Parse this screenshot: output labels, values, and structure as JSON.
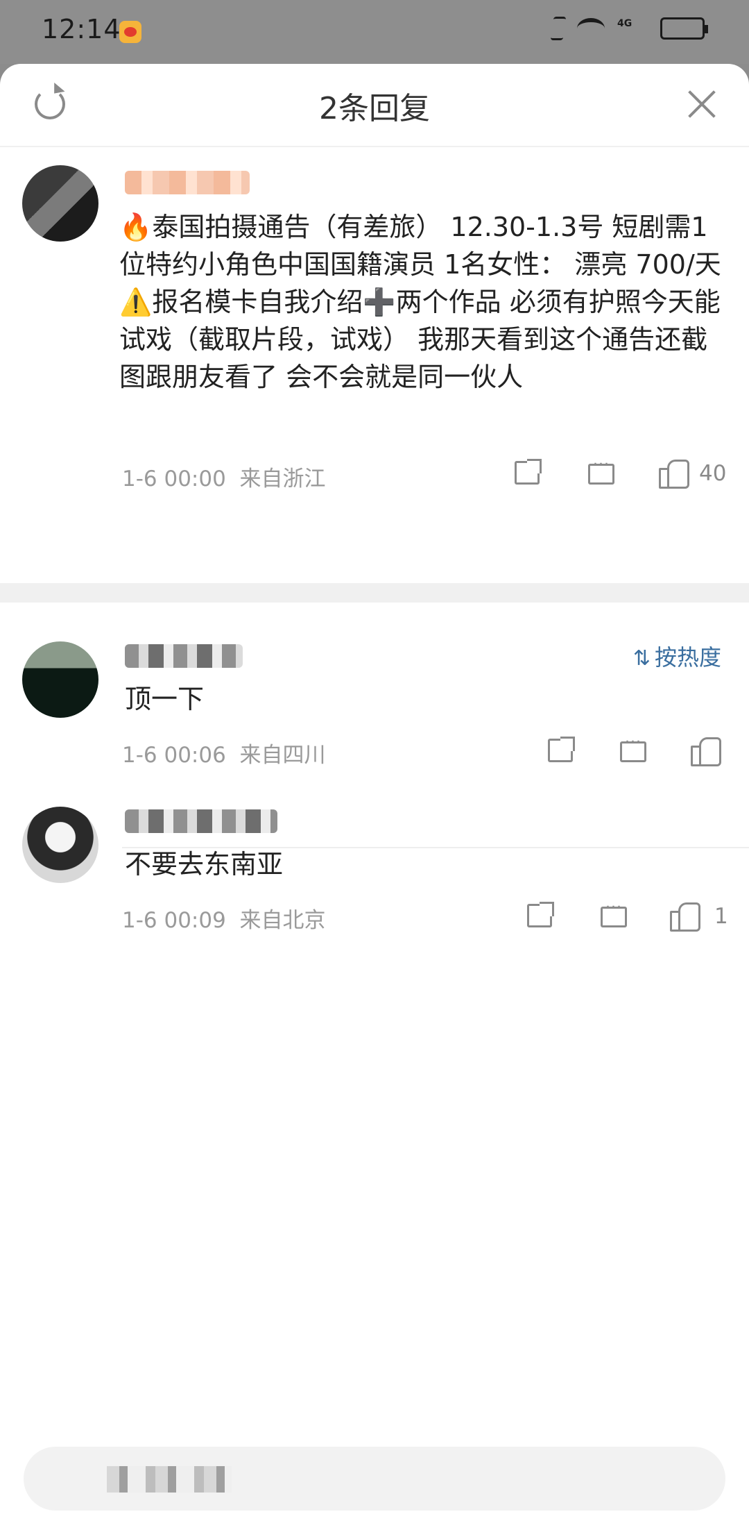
{
  "status_bar": {
    "time": "12:14"
  },
  "header": {
    "title": "2条回复"
  },
  "post": {
    "text": "🔥泰国拍摄通告（有差旅） 12.30-1.3号 短剧需1位特约小角色中国国籍演员 1名女性： 漂亮 700/天 ⚠️报名模卡自我介绍➕两个作品 必须有护照今天能试戏（截取片段，试戏） 我那天看到这个通告还截图跟朋友看了 会不会就是同一伙人",
    "time": "1-6 00:00",
    "location": "来自浙江",
    "likes": "40"
  },
  "sort": {
    "label": "按热度"
  },
  "replies": [
    {
      "text": "顶一下",
      "time": "1-6 00:06",
      "location": "来自四川",
      "likes": ""
    },
    {
      "text": "不要去东南亚",
      "time": "1-6 00:09",
      "location": "来自北京",
      "likes": "1"
    }
  ]
}
